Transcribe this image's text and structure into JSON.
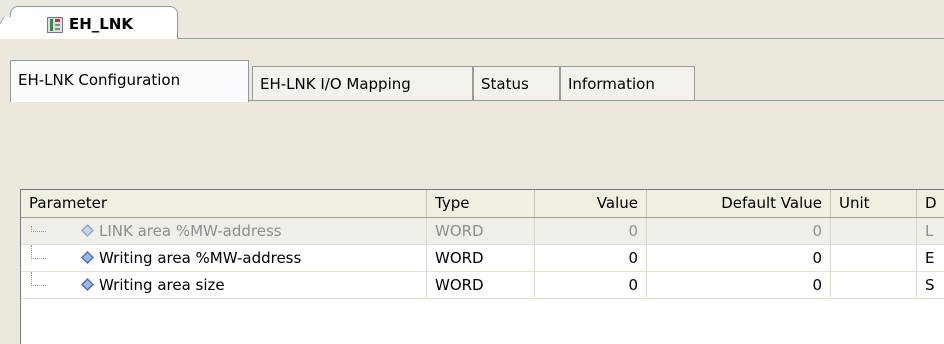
{
  "editor": {
    "tab_label": "EH_LNK"
  },
  "tabs": [
    {
      "label": "EH-LNK Configuration",
      "active": true
    },
    {
      "label": "EH-LNK I/O Mapping",
      "active": false
    },
    {
      "label": "Status",
      "active": false
    },
    {
      "label": "Information",
      "active": false
    }
  ],
  "table": {
    "headers": {
      "parameter": "Parameter",
      "type": "Type",
      "value": "Value",
      "default_value": "Default Value",
      "unit": "Unit",
      "description": "D"
    },
    "rows": [
      {
        "parameter": "LINK area %MW-address",
        "type": "WORD",
        "value": "0",
        "default_value": "0",
        "unit": "",
        "description": "L",
        "disabled": true
      },
      {
        "parameter": "Writing area %MW-address",
        "type": "WORD",
        "value": "0",
        "default_value": "0",
        "unit": "",
        "description": "E",
        "disabled": false
      },
      {
        "parameter": "Writing area size",
        "type": "WORD",
        "value": "0",
        "default_value": "0",
        "unit": "",
        "description": "S",
        "disabled": false
      }
    ]
  },
  "colors": {
    "background": "#ebe9de",
    "param_icon": "#4a6fb3",
    "disabled_text": "#8e8e8e"
  }
}
